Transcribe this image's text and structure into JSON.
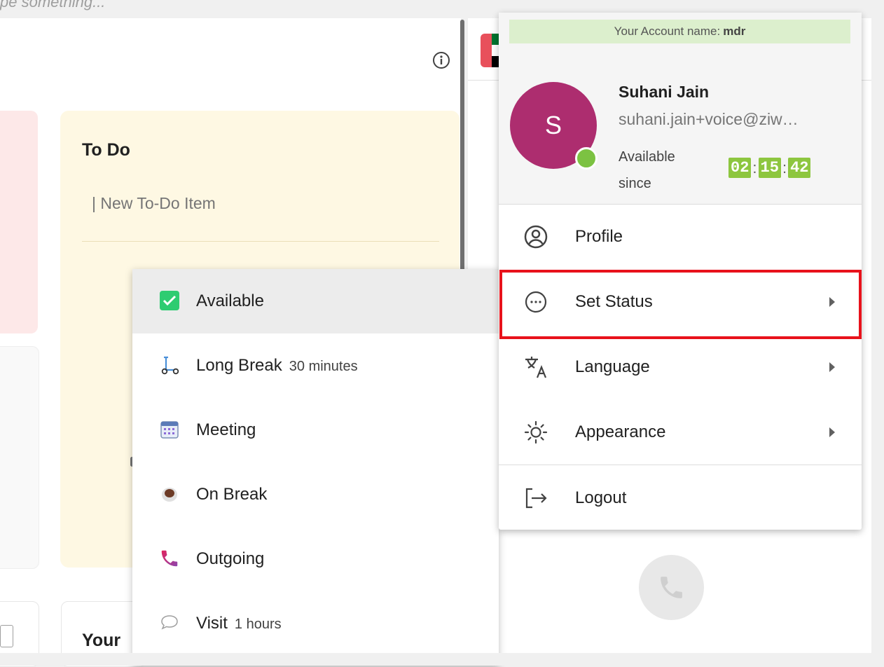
{
  "search": {
    "placeholder_partial": "pe something..."
  },
  "todo": {
    "title": "To Do",
    "new_item": "| New To-Do Item"
  },
  "your_card": {
    "title": "Your"
  },
  "small_box_text": "ʼ",
  "account": {
    "name_label": "Your Account name:",
    "name_value": "mdr",
    "avatar_letter": "S",
    "user_name": "Suhani Jain",
    "user_email": "suhani.jain+voice@ziw…",
    "availability_label": "Available since",
    "timer": {
      "hours": "02",
      "minutes": "15",
      "seconds": "42"
    },
    "status_color": "#7cc242",
    "avatar_color": "#ad2d6f"
  },
  "account_menu": {
    "items": [
      {
        "label": "Profile",
        "icon": "user-circle-icon",
        "has_submenu": false
      },
      {
        "label": "Set Status",
        "icon": "more-horizontal-circle-icon",
        "has_submenu": true,
        "highlighted": true
      },
      {
        "label": "Language",
        "icon": "translate-icon",
        "has_submenu": true
      },
      {
        "label": "Appearance",
        "icon": "sun-icon",
        "has_submenu": true
      },
      {
        "label": "Logout",
        "icon": "logout-icon",
        "has_submenu": false
      }
    ]
  },
  "status_menu": {
    "items": [
      {
        "label": "Available",
        "sub": "",
        "icon": "checkbox-checked-icon",
        "selected": true
      },
      {
        "label": "Long Break",
        "sub": "30 minutes",
        "icon": "scooter-icon"
      },
      {
        "label": "Meeting",
        "sub": "",
        "icon": "calendar-icon"
      },
      {
        "label": "On Break",
        "sub": "",
        "icon": "coffee-cup-icon"
      },
      {
        "label": "Outgoing",
        "sub": "",
        "icon": "phone-icon"
      },
      {
        "label": "Visit",
        "sub": "1 hours",
        "icon": "speech-bubble-icon"
      }
    ]
  },
  "colors": {
    "highlight": "#e8121b",
    "todo_bg": "#fef8e3",
    "available_green": "#2ecc71"
  }
}
